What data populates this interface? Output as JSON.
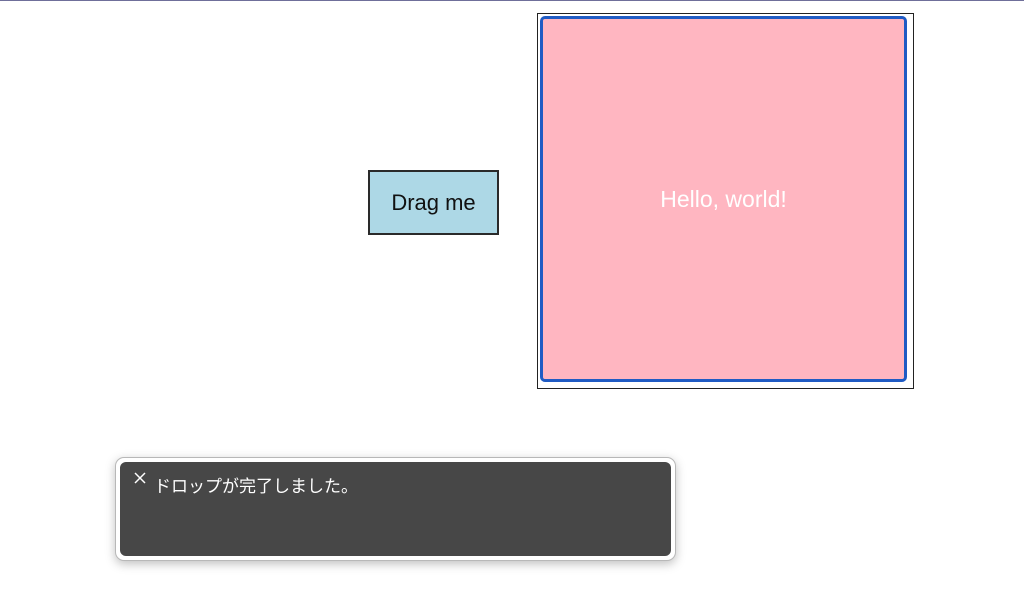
{
  "drag_source": {
    "label": "Drag me",
    "background": "#add8e6"
  },
  "drop_target": {
    "text": "Hello, world!",
    "background": "#ffb6c1",
    "border_color": "#1f5bc4"
  },
  "toast": {
    "close_icon": "close-icon",
    "message": "ドロップが完了しました。",
    "background": "#474747"
  }
}
